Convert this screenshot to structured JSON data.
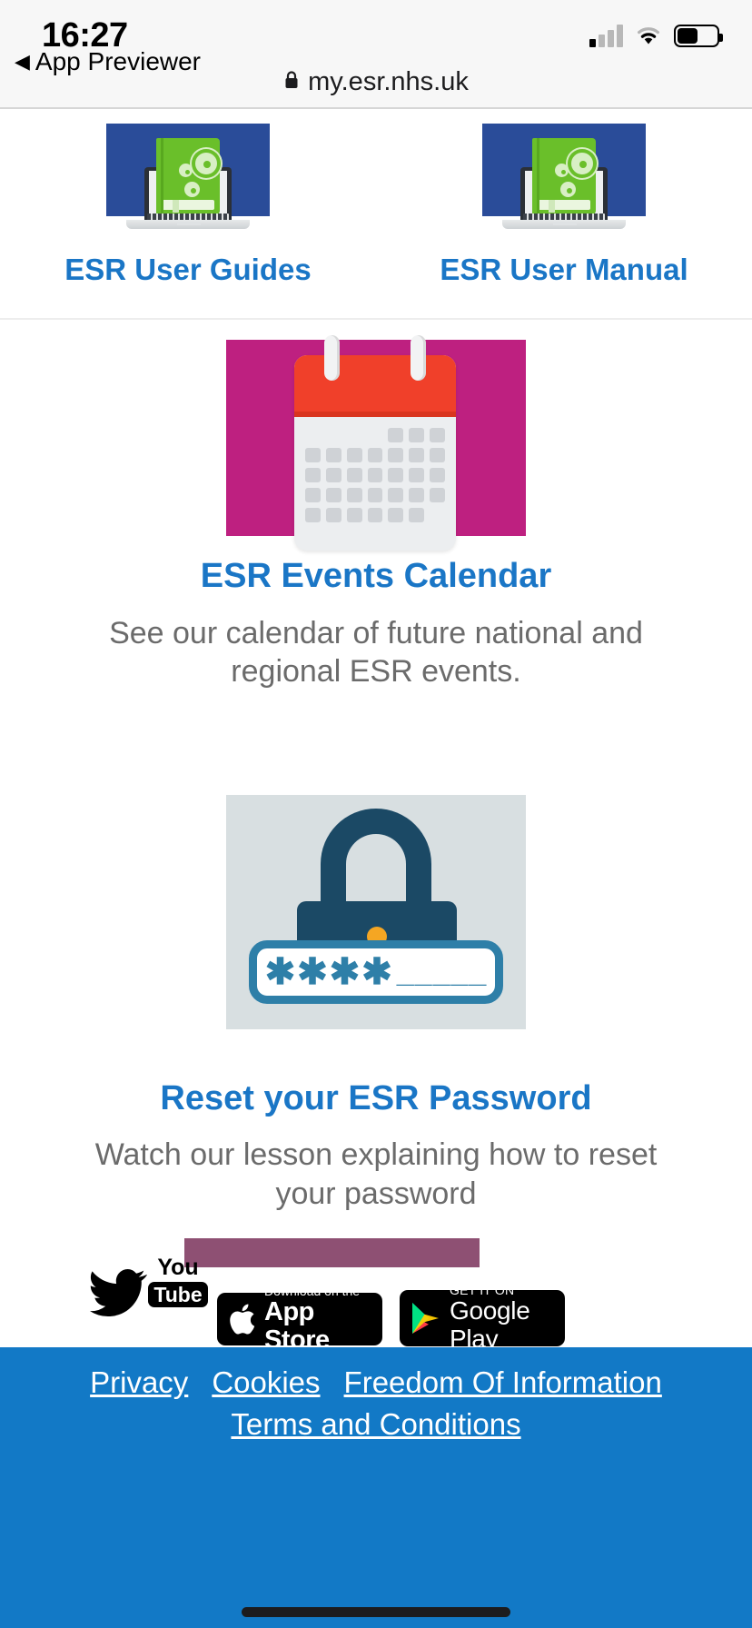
{
  "statusbar": {
    "time": "16:27",
    "back_label": "App Previewer",
    "back_caret": "◀",
    "signal_icon": "cellular-signal-icon",
    "wifi_icon": "wifi-icon",
    "battery_icon": "battery-icon"
  },
  "browser": {
    "lock_glyph": "🔒",
    "url": "my.esr.nhs.uk"
  },
  "tiles": [
    {
      "label": "ESR User Guides",
      "image": "laptop-book-gears-image"
    },
    {
      "label": "ESR User Manual",
      "image": "laptop-book-gears-image"
    }
  ],
  "calendar_block": {
    "link_label": "ESR Events Calendar",
    "description": "See our calendar of future national and regional ESR events.",
    "image": "events-calendar-image",
    "bg_color": "#be2080",
    "header_color": "#f0402a"
  },
  "password_block": {
    "link_label": "Reset your ESR Password",
    "description": "Watch our lesson explaining how to reset your password",
    "image": "padlock-password-image",
    "bg_color": "#d8dfe1",
    "lock_color": "#1b4965",
    "field_stars": "✱✱✱✱",
    "field_dashes": "_____"
  },
  "social": [
    {
      "name": "twitter-icon",
      "label": "Twitter"
    },
    {
      "name": "youtube-icon",
      "label_top": "You",
      "label_bottom": "Tube"
    }
  ],
  "store_badges": {
    "app_store": {
      "small": "Download on the",
      "big": "App Store"
    },
    "google_play": {
      "small": "GET IT ON",
      "big": "Google Play"
    }
  },
  "footer": {
    "bg_color": "#1279c6",
    "links": [
      "Privacy",
      "Cookies",
      "Freedom Of Information",
      "Terms and Conditions"
    ]
  },
  "theme": {
    "link_blue": "#1a76c6",
    "tile_blue": "#2a4c99",
    "text_gray": "#6b6b6b"
  }
}
